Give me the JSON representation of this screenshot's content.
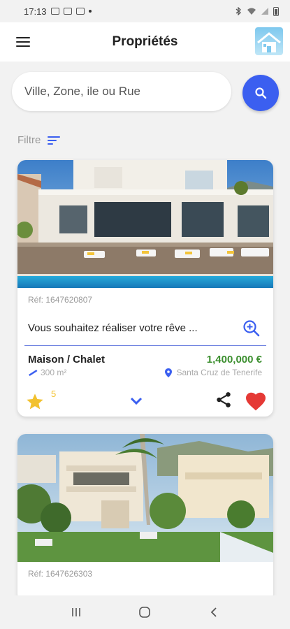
{
  "status_bar": {
    "time": "17:13"
  },
  "app_bar": {
    "title": "Propriétés"
  },
  "search": {
    "placeholder": "Ville, Zone, ile ou Rue"
  },
  "filter": {
    "label": "Filtre"
  },
  "listings": [
    {
      "ref": "Réf: 1647620807",
      "headline": "Vous souhaitez réaliser votre rêve ...",
      "type": "Maison / Chalet",
      "price": "1,400,000 €",
      "area": "300 m²",
      "location": "Santa Cruz de Tenerife",
      "rating": "5"
    },
    {
      "ref": "Réf: 1647626303"
    }
  ],
  "colors": {
    "accent": "#3b5ff0",
    "price": "#3c8f2f",
    "star": "#f2c12e",
    "heart": "#e53935"
  }
}
